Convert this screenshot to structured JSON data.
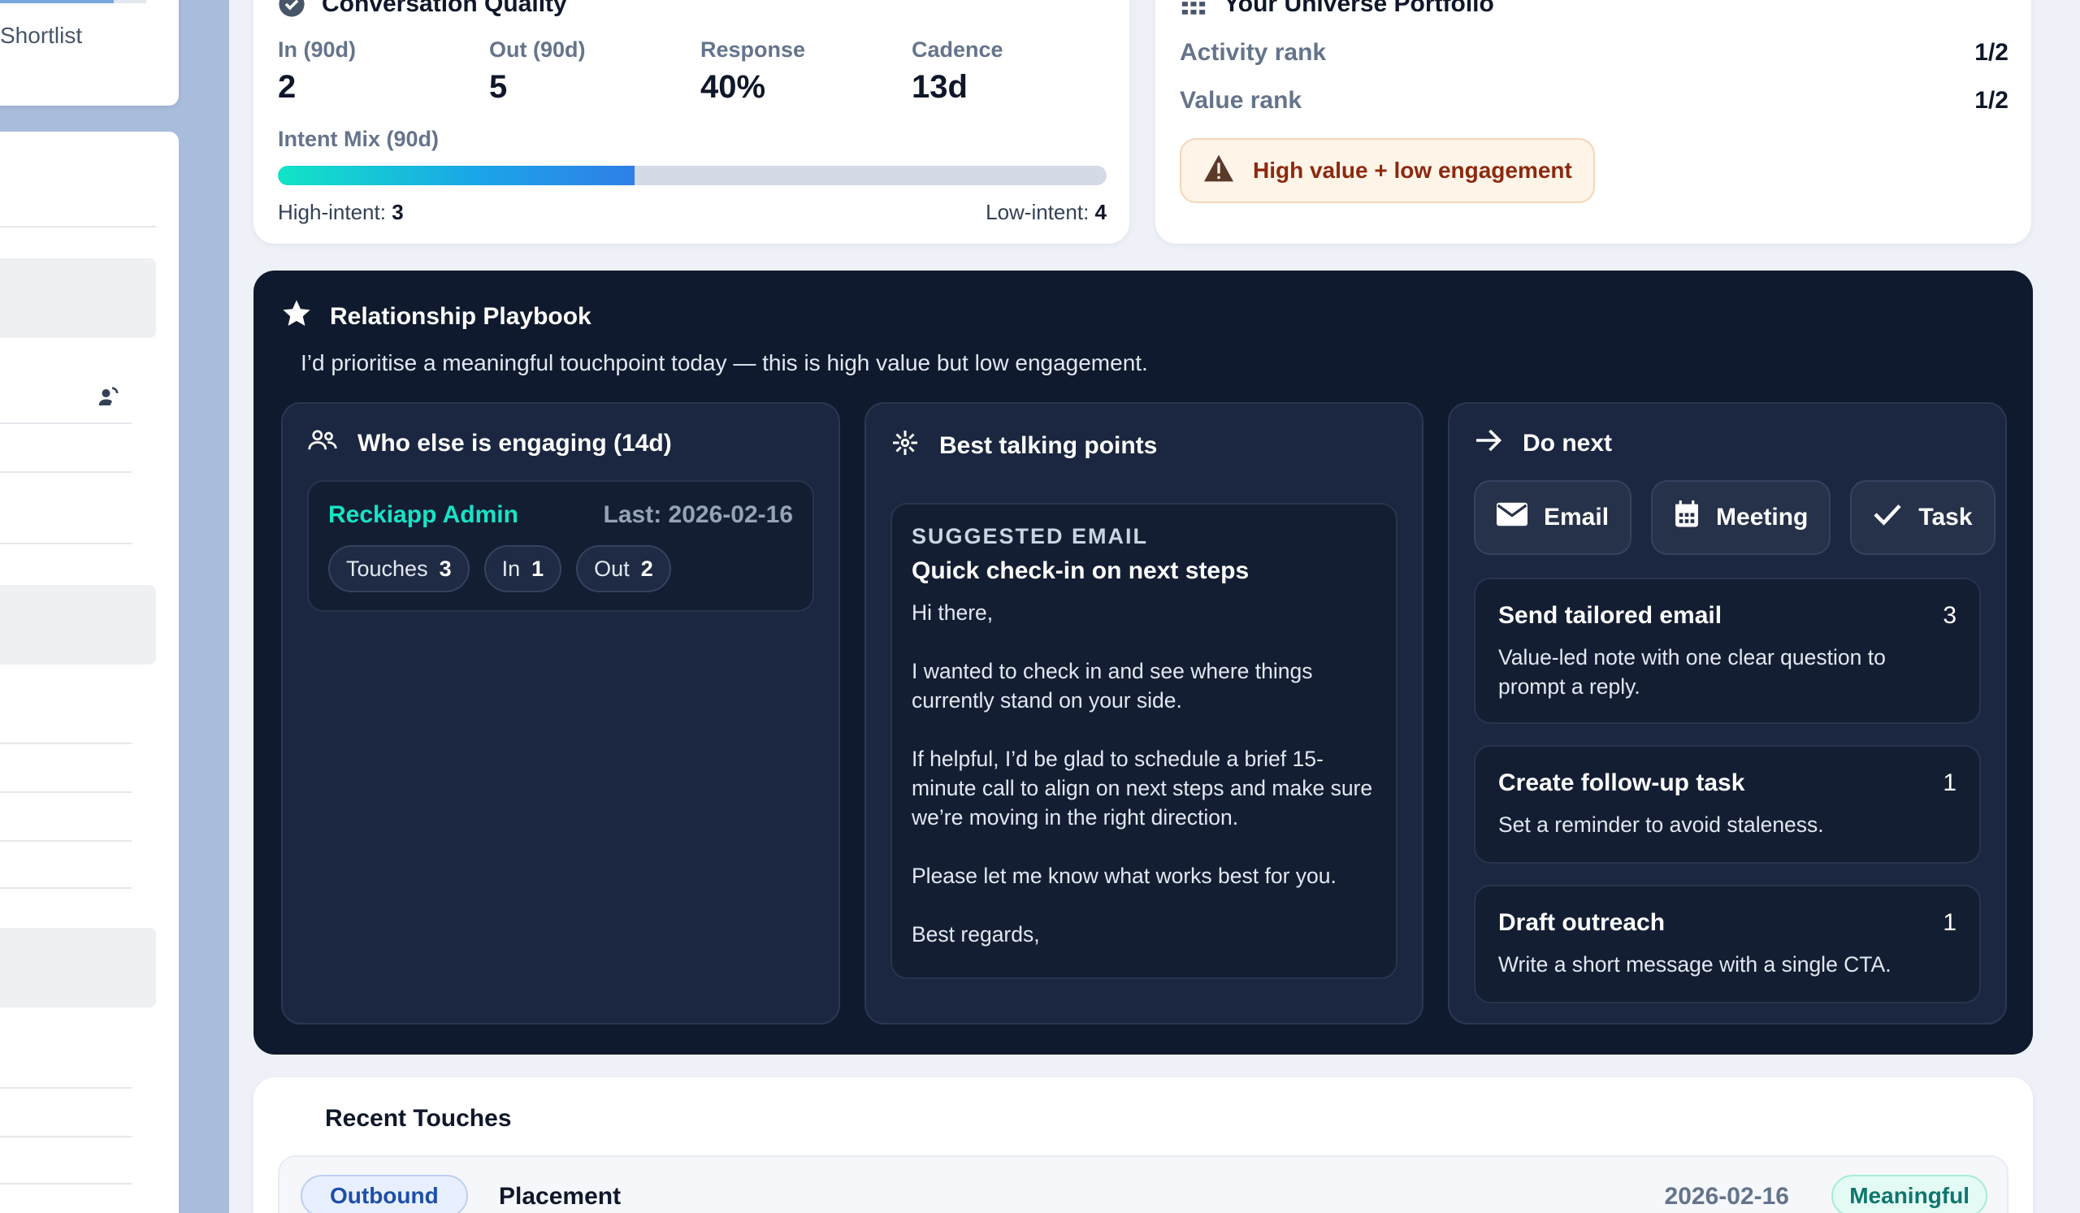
{
  "sidebar": {
    "shortlist_label": "Shortlist"
  },
  "conversation_quality": {
    "title": "Conversation Quality",
    "stats": [
      {
        "label": "In (90d)",
        "value": "2"
      },
      {
        "label": "Out (90d)",
        "value": "5"
      },
      {
        "label": "Response",
        "value": "40%"
      },
      {
        "label": "Cadence",
        "value": "13d"
      }
    ],
    "intent_mix_label": "Intent Mix (90d)",
    "intent_fill_fraction": 0.43,
    "high_intent_label": "High-intent:",
    "high_intent_value": "3",
    "low_intent_label": "Low-intent:",
    "low_intent_value": "4"
  },
  "universe_portfolio": {
    "title": "Your Universe Portfolio",
    "activity_rank_label": "Activity rank",
    "activity_rank_value": "1/2",
    "value_rank_label": "Value rank",
    "value_rank_value": "1/2",
    "warning": "High value + low engagement"
  },
  "playbook": {
    "title": "Relationship Playbook",
    "subtitle": "I’d prioritise a meaningful touchpoint today — this is high value but low engagement.",
    "engaging": {
      "title": "Who else is engaging (14d)",
      "name": "Reckiapp Admin",
      "last": "Last: 2026-02-16",
      "chips": [
        {
          "label": "Touches",
          "value": "3"
        },
        {
          "label": "In",
          "value": "1"
        },
        {
          "label": "Out",
          "value": "2"
        }
      ]
    },
    "talking_points": {
      "title": "Best talking points",
      "kicker": "SUGGESTED EMAIL",
      "subject": "Quick check-in on next steps",
      "greeting": "Hi there,",
      "p1": "I wanted to check in and see where things currently stand on your side.",
      "p2": "If helpful, I’d be glad to schedule a brief 15-minute call to align on next steps and make sure we’re moving in the right direction.",
      "p3": "Please let me know what works best for you.",
      "signoff": "Best regards,"
    },
    "do_next": {
      "title": "Do next",
      "buttons": [
        "Email",
        "Meeting",
        "Task"
      ],
      "items": [
        {
          "title": "Send tailored email",
          "count": "3",
          "desc": "Value-led note with one clear question to prompt a reply."
        },
        {
          "title": "Create follow-up task",
          "count": "1",
          "desc": "Set a reminder to avoid staleness."
        },
        {
          "title": "Draft outreach",
          "count": "1",
          "desc": "Write a short message with a single CTA."
        }
      ]
    }
  },
  "recent_touches": {
    "title": "Recent Touches",
    "rows": [
      {
        "direction": "Outbound",
        "type": "Placement",
        "date": "2026-02-16",
        "quality": "Meaningful"
      }
    ]
  },
  "colors": {
    "accent_teal": "#18e3c5",
    "playbook_bg": "#101a2e",
    "warning_text": "#8b2a0f"
  }
}
